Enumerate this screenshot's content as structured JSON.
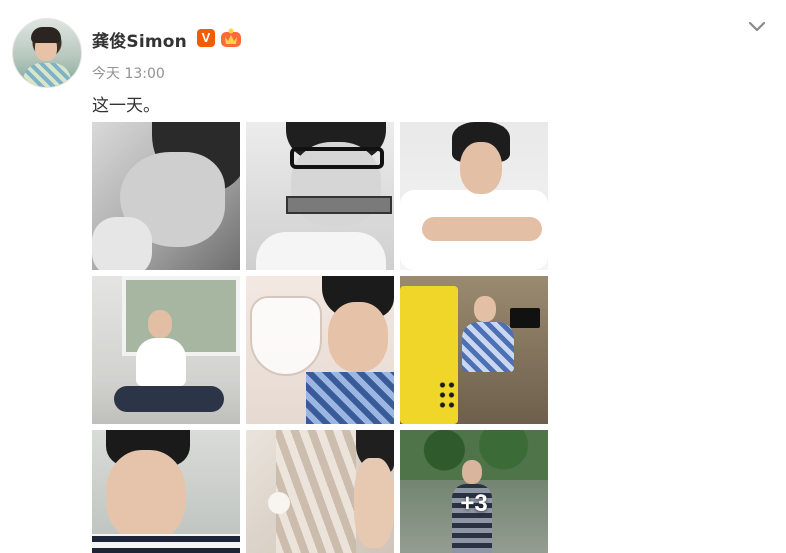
{
  "post": {
    "username": "龚俊Simon",
    "verified_label": "V",
    "timestamp": "今天 13:00",
    "text": "这一天。",
    "more_count_label": "+3",
    "colors": {
      "username": "#333333",
      "timestamp": "#939393",
      "verified_badge": "#f25c05"
    },
    "icons": [
      "chevron-down-icon",
      "verified-badge-icon",
      "crown-badge-icon"
    ],
    "photos": [
      {
        "desc": "bw-closeup-eyes-closed"
      },
      {
        "desc": "bw-glasses-harmonica"
      },
      {
        "desc": "lying-on-pillow"
      },
      {
        "desc": "sitting-by-window"
      },
      {
        "desc": "holding-glass-bowl"
      },
      {
        "desc": "arcade-cabinet"
      },
      {
        "desc": "portrait-striped-shirt"
      },
      {
        "desc": "blurred-fabric-closeup"
      },
      {
        "desc": "standing-under-tree"
      }
    ]
  }
}
